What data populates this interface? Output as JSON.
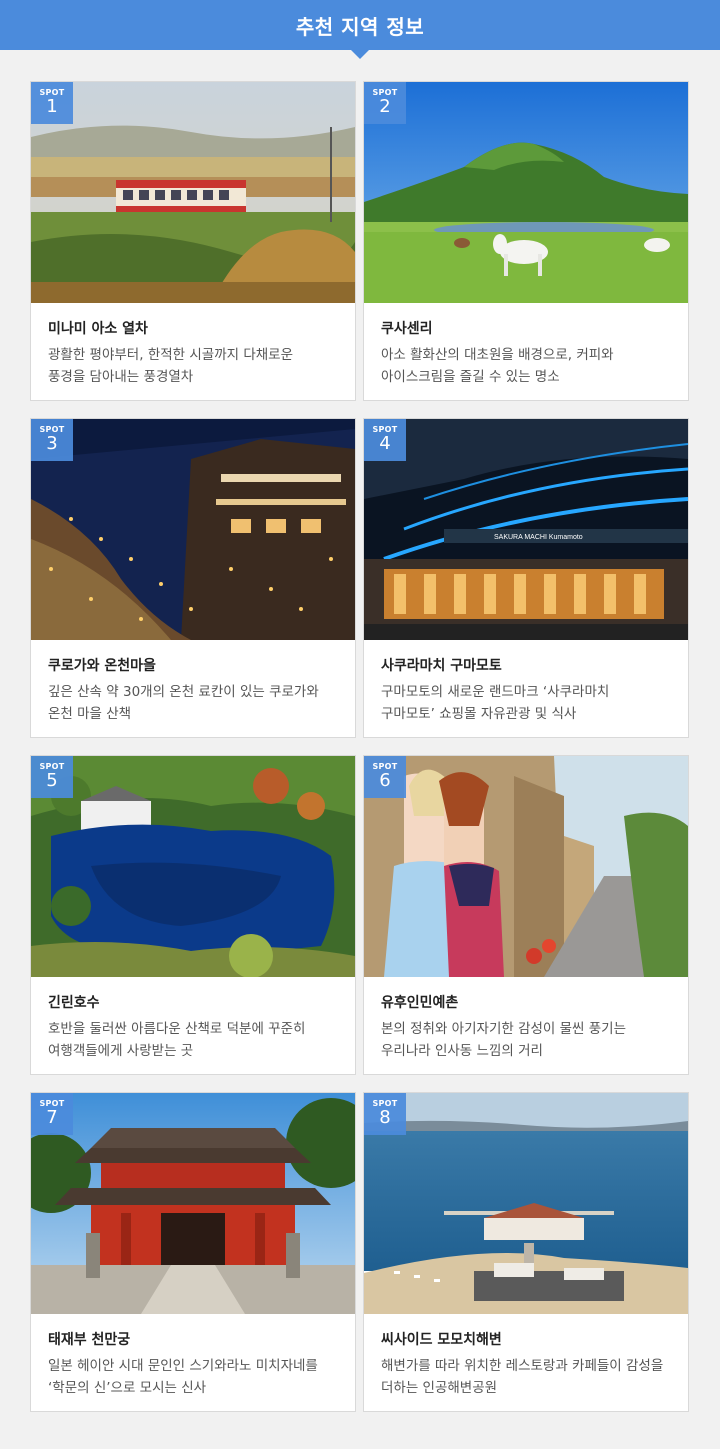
{
  "header": {
    "title": "추천 지역 정보"
  },
  "spot_label": "SPOT",
  "spots": [
    {
      "num": "1",
      "name": "미나미 아소 열차",
      "desc": "광활한 평야부터, 한적한 시골까지 다채로운\n풍경을 담아내는 풍경열차"
    },
    {
      "num": "2",
      "name": "쿠사센리",
      "desc": "아소 활화산의 대초원을 배경으로, 커피와\n아이스크림을 즐길 수 있는 명소"
    },
    {
      "num": "3",
      "name": "쿠로가와 온천마을",
      "desc": "깊은 산속 약 30개의 온천 료칸이 있는 쿠로가와\n온천 마을 산책"
    },
    {
      "num": "4",
      "name": "사쿠라마치 구마모토",
      "desc": "구마모토의 새로운 랜드마크 ‘사쿠라마치\n구마모토’ 쇼핑몰 자유관광 및 식사"
    },
    {
      "num": "5",
      "name": "긴린호수",
      "desc": "호반을 둘러싼 아름다운 산책로 덕분에 꾸준히\n여행객들에게 사랑받는 곳"
    },
    {
      "num": "6",
      "name": "유후인민예촌",
      "desc": "본의 정취와 아기자기한 감성이 물씬 풍기는\n우리나라 인사동 느낌의 거리"
    },
    {
      "num": "7",
      "name": "태재부 천만궁",
      "desc": "일본 헤이안 시대 문인인 스기와라노 미치자네를\n‘학문의 신’으로 모시는 신사"
    },
    {
      "num": "8",
      "name": "씨사이드 모모치해변",
      "desc": "해변가를 따라 위치한 레스토랑과 카페들이 감성을\n더하는 인공해변공원"
    }
  ],
  "sign_text": "SAKURA MACHI Kumamoto",
  "colors": {
    "accent": "#4b8bdc",
    "background": "#f1f1f1"
  }
}
